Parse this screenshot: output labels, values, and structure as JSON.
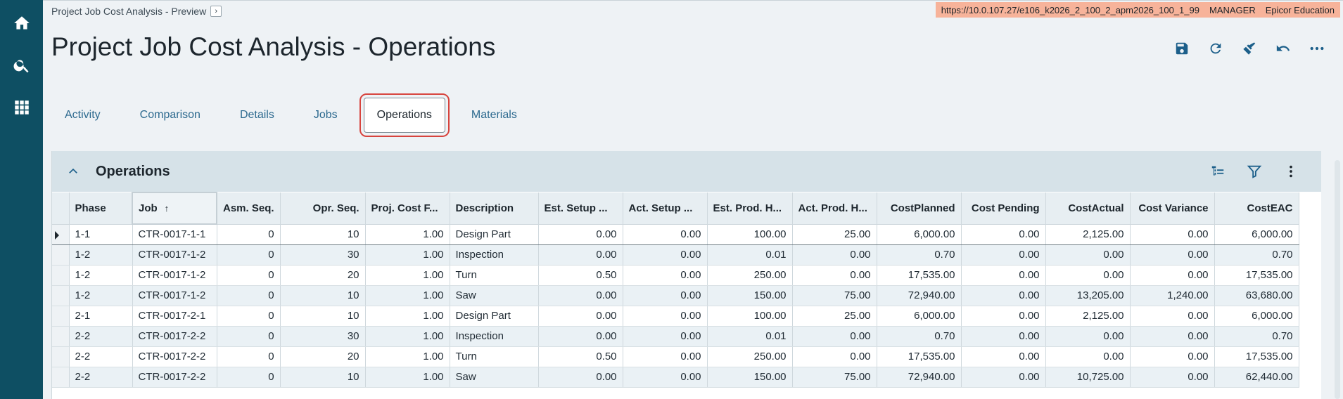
{
  "breadcrumb": {
    "text": "Project Job Cost Analysis - Preview",
    "btn": "›"
  },
  "env": {
    "url": "https://10.0.107.27/e106_k2026_2_100_2_apm2026_100_1_99",
    "user": "MANAGER",
    "company": "Epicor Education"
  },
  "page_title": "Project Job Cost Analysis - Operations",
  "sidebar_icons": [
    "home-icon",
    "search-icon",
    "apps-grid-icon"
  ],
  "toolbar_icons": [
    "save-icon",
    "refresh-icon",
    "clear-icon",
    "undo-icon",
    "more-icon"
  ],
  "tabs": [
    "Activity",
    "Comparison",
    "Details",
    "Jobs",
    "Operations",
    "Materials"
  ],
  "active_tab": "Operations",
  "panel": {
    "title": "Operations",
    "sort_indicator": "↑"
  },
  "colors": {
    "sidebar": "#0e4f63",
    "accent": "#1c5f8a",
    "highlight": "#d7443e",
    "env_bar": "#f7b39a"
  },
  "columns": [
    "Phase",
    "Job",
    "Asm. Seq.",
    "Opr. Seq.",
    "Proj. Cost F...",
    "Description",
    "Est. Setup ...",
    "Act. Setup ...",
    "Est. Prod. H...",
    "Act. Prod. H...",
    "CostPlanned",
    "Cost Pending",
    "CostActual",
    "Cost Variance",
    "CostEAC"
  ],
  "rows": [
    [
      "1-1",
      "CTR-0017-1-1",
      "0",
      "10",
      "1.00",
      "Design Part",
      "0.00",
      "0.00",
      "100.00",
      "25.00",
      "6,000.00",
      "0.00",
      "2,125.00",
      "0.00",
      "6,000.00"
    ],
    [
      "1-2",
      "CTR-0017-1-2",
      "0",
      "30",
      "1.00",
      "Inspection",
      "0.00",
      "0.00",
      "0.01",
      "0.00",
      "0.70",
      "0.00",
      "0.00",
      "0.00",
      "0.70"
    ],
    [
      "1-2",
      "CTR-0017-1-2",
      "0",
      "20",
      "1.00",
      "Turn",
      "0.50",
      "0.00",
      "250.00",
      "0.00",
      "17,535.00",
      "0.00",
      "0.00",
      "0.00",
      "17,535.00"
    ],
    [
      "1-2",
      "CTR-0017-1-2",
      "0",
      "10",
      "1.00",
      "Saw",
      "0.00",
      "0.00",
      "150.00",
      "75.00",
      "72,940.00",
      "0.00",
      "13,205.00",
      "1,240.00",
      "63,680.00"
    ],
    [
      "2-1",
      "CTR-0017-2-1",
      "0",
      "10",
      "1.00",
      "Design Part",
      "0.00",
      "0.00",
      "100.00",
      "25.00",
      "6,000.00",
      "0.00",
      "2,125.00",
      "0.00",
      "6,000.00"
    ],
    [
      "2-2",
      "CTR-0017-2-2",
      "0",
      "30",
      "1.00",
      "Inspection",
      "0.00",
      "0.00",
      "0.01",
      "0.00",
      "0.70",
      "0.00",
      "0.00",
      "0.00",
      "0.70"
    ],
    [
      "2-2",
      "CTR-0017-2-2",
      "0",
      "20",
      "1.00",
      "Turn",
      "0.50",
      "0.00",
      "250.00",
      "0.00",
      "17,535.00",
      "0.00",
      "0.00",
      "0.00",
      "17,535.00"
    ],
    [
      "2-2",
      "CTR-0017-2-2",
      "0",
      "10",
      "1.00",
      "Saw",
      "0.00",
      "0.00",
      "150.00",
      "75.00",
      "72,940.00",
      "0.00",
      "10,725.00",
      "0.00",
      "62,440.00"
    ]
  ]
}
